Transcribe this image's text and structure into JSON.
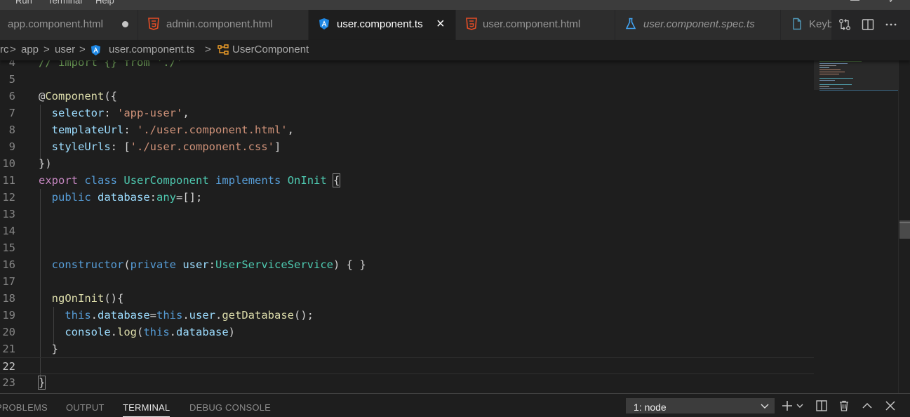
{
  "menubar": {
    "items": [
      "Run",
      "Terminal",
      "Help"
    ],
    "window_controls": [
      "—",
      "✓"
    ]
  },
  "tabs": [
    {
      "label": "app.component.html",
      "icon": "none",
      "dirty": true,
      "active": false,
      "italic": false
    },
    {
      "label": "admin.component.html",
      "icon": "html5-icon",
      "dirty": false,
      "active": false,
      "italic": false
    },
    {
      "label": "user.component.ts",
      "icon": "angular-icon",
      "dirty": false,
      "active": true,
      "italic": false
    },
    {
      "label": "user.component.html",
      "icon": "html5-icon",
      "dirty": false,
      "active": false,
      "italic": false
    },
    {
      "label": "user.component.spec.ts",
      "icon": "flask-icon",
      "dirty": false,
      "active": false,
      "italic": true
    },
    {
      "label": "Keyb",
      "icon": "file-icon",
      "dirty": false,
      "active": false,
      "italic": false
    }
  ],
  "tab_actions": [
    "open-changes-icon",
    "split-editor-icon",
    "more-actions-icon"
  ],
  "breadcrumbs": {
    "items": [
      "rc",
      "app",
      "user",
      "user.component.ts",
      "UserComponent"
    ],
    "separator": ">"
  },
  "editor": {
    "current_line": "22",
    "lines": [
      {
        "n": "4",
        "tokens": [
          [
            "cm",
            "// import {} from './'"
          ]
        ]
      },
      {
        "n": "5",
        "tokens": []
      },
      {
        "n": "6",
        "tokens": [
          [
            "p",
            "@"
          ],
          [
            "dec",
            "Component"
          ],
          [
            "p",
            "({"
          ]
        ]
      },
      {
        "n": "7",
        "tokens": [
          [
            "p",
            "  "
          ],
          [
            "prop",
            "selector"
          ],
          [
            "p",
            ": "
          ],
          [
            "str",
            "'app-user'"
          ],
          [
            "p",
            ","
          ]
        ]
      },
      {
        "n": "8",
        "tokens": [
          [
            "p",
            "  "
          ],
          [
            "prop",
            "templateUrl"
          ],
          [
            "p",
            ": "
          ],
          [
            "str",
            "'./user.component.html'"
          ],
          [
            "p",
            ","
          ]
        ]
      },
      {
        "n": "9",
        "tokens": [
          [
            "p",
            "  "
          ],
          [
            "prop",
            "styleUrls"
          ],
          [
            "p",
            ": ["
          ],
          [
            "str",
            "'./user.component.css'"
          ],
          [
            "p",
            "]"
          ]
        ]
      },
      {
        "n": "10",
        "tokens": [
          [
            "p",
            "})"
          ]
        ]
      },
      {
        "n": "11",
        "tokens": [
          [
            "kw2",
            "export"
          ],
          [
            "p",
            " "
          ],
          [
            "kw",
            "class"
          ],
          [
            "p",
            " "
          ],
          [
            "cls",
            "UserComponent"
          ],
          [
            "p",
            " "
          ],
          [
            "kw",
            "implements"
          ],
          [
            "p",
            " "
          ],
          [
            "cls",
            "OnInit"
          ],
          [
            "p",
            " "
          ],
          [
            "hl",
            "{"
          ]
        ]
      },
      {
        "n": "12",
        "tokens": [
          [
            "p",
            "  "
          ],
          [
            "kw",
            "public"
          ],
          [
            "p",
            " "
          ],
          [
            "prop",
            "database"
          ],
          [
            "p",
            ":"
          ],
          [
            "cls",
            "any"
          ],
          [
            "p",
            "=[];"
          ]
        ]
      },
      {
        "n": "13",
        "tokens": []
      },
      {
        "n": "14",
        "tokens": []
      },
      {
        "n": "15",
        "tokens": []
      },
      {
        "n": "16",
        "tokens": [
          [
            "p",
            "  "
          ],
          [
            "kw",
            "constructor"
          ],
          [
            "p",
            "("
          ],
          [
            "kw",
            "private"
          ],
          [
            "p",
            " "
          ],
          [
            "prop",
            "user"
          ],
          [
            "p",
            ":"
          ],
          [
            "cls",
            "UserServiceService"
          ],
          [
            "p",
            ") { }"
          ]
        ]
      },
      {
        "n": "17",
        "tokens": []
      },
      {
        "n": "18",
        "tokens": [
          [
            "p",
            "  "
          ],
          [
            "fn",
            "ngOnInit"
          ],
          [
            "p",
            "(){"
          ]
        ]
      },
      {
        "n": "19",
        "tokens": [
          [
            "p",
            "    "
          ],
          [
            "kw",
            "this"
          ],
          [
            "p",
            "."
          ],
          [
            "prop",
            "database"
          ],
          [
            "p",
            "="
          ],
          [
            "kw",
            "this"
          ],
          [
            "p",
            "."
          ],
          [
            "prop",
            "user"
          ],
          [
            "p",
            "."
          ],
          [
            "fn",
            "getDatabase"
          ],
          [
            "p",
            "();"
          ]
        ]
      },
      {
        "n": "20",
        "tokens": [
          [
            "p",
            "    "
          ],
          [
            "prop",
            "console"
          ],
          [
            "p",
            "."
          ],
          [
            "fn",
            "log"
          ],
          [
            "p",
            "("
          ],
          [
            "kw",
            "this"
          ],
          [
            "p",
            "."
          ],
          [
            "prop",
            "database"
          ],
          [
            "p",
            ")"
          ]
        ]
      },
      {
        "n": "21",
        "tokens": [
          [
            "p",
            "  }"
          ]
        ]
      },
      {
        "n": "22",
        "tokens": []
      },
      {
        "n": "23",
        "tokens": [
          [
            "hl",
            "}"
          ]
        ]
      }
    ]
  },
  "panel": {
    "tabs": [
      {
        "label": "PROBLEMS",
        "active": false
      },
      {
        "label": "OUTPUT",
        "active": false
      },
      {
        "label": "TERMINAL",
        "active": true
      },
      {
        "label": "DEBUG CONSOLE",
        "active": false
      }
    ],
    "terminal_select": "1: node",
    "actions": [
      "new-terminal-icon",
      "dropdown-icon",
      "split-terminal-icon",
      "kill-terminal-icon",
      "maximize-panel-icon",
      "close-panel-icon"
    ]
  },
  "colors": {
    "accent": "#007acc",
    "html_icon": "#e44d26",
    "angular_icon": "#1e88e5",
    "flask_icon": "#42a5f5",
    "file_icon": "#519aba"
  }
}
